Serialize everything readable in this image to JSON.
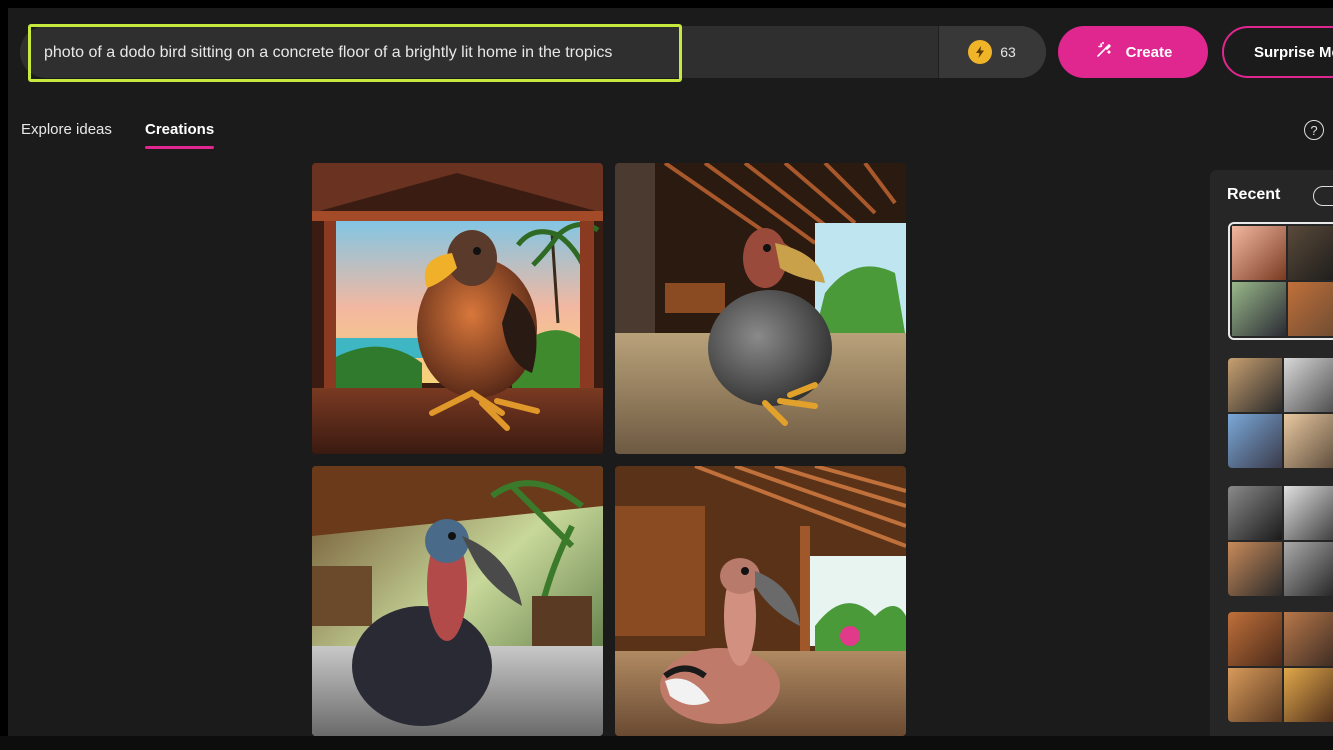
{
  "prompt": {
    "text": "photo of a dodo bird sitting on a concrete floor of a brightly lit home in the tropics",
    "highlight_color": "#c7e83c"
  },
  "boosts": {
    "icon": "lightning-bolt-icon",
    "count": "63"
  },
  "buttons": {
    "create_label": "Create",
    "create_icon": "magic-brush-icon",
    "surprise_label": "Surprise Me",
    "accent": "#e0268f"
  },
  "tabs": [
    {
      "label": "Explore ideas",
      "active": false
    },
    {
      "label": "Creations",
      "active": true
    }
  ],
  "help": {
    "icon": "question-circle-icon",
    "glyph": "?"
  },
  "results": {
    "images": [
      {
        "subject": "dodo-bird-sunset-beach-view"
      },
      {
        "subject": "dodo-bird-wooden-lodge-interior"
      },
      {
        "subject": "dodo-bird-blue-head-palm-patio"
      },
      {
        "subject": "dodo-bird-pink-neck-terrace"
      }
    ]
  },
  "recent": {
    "title": "Recent",
    "groups": [
      {
        "selected": true,
        "theme": "dodo"
      },
      {
        "selected": false,
        "theme": "robot-photographer"
      },
      {
        "selected": false,
        "theme": "robot-camera-studio"
      },
      {
        "selected": false,
        "theme": "dodo"
      }
    ]
  }
}
